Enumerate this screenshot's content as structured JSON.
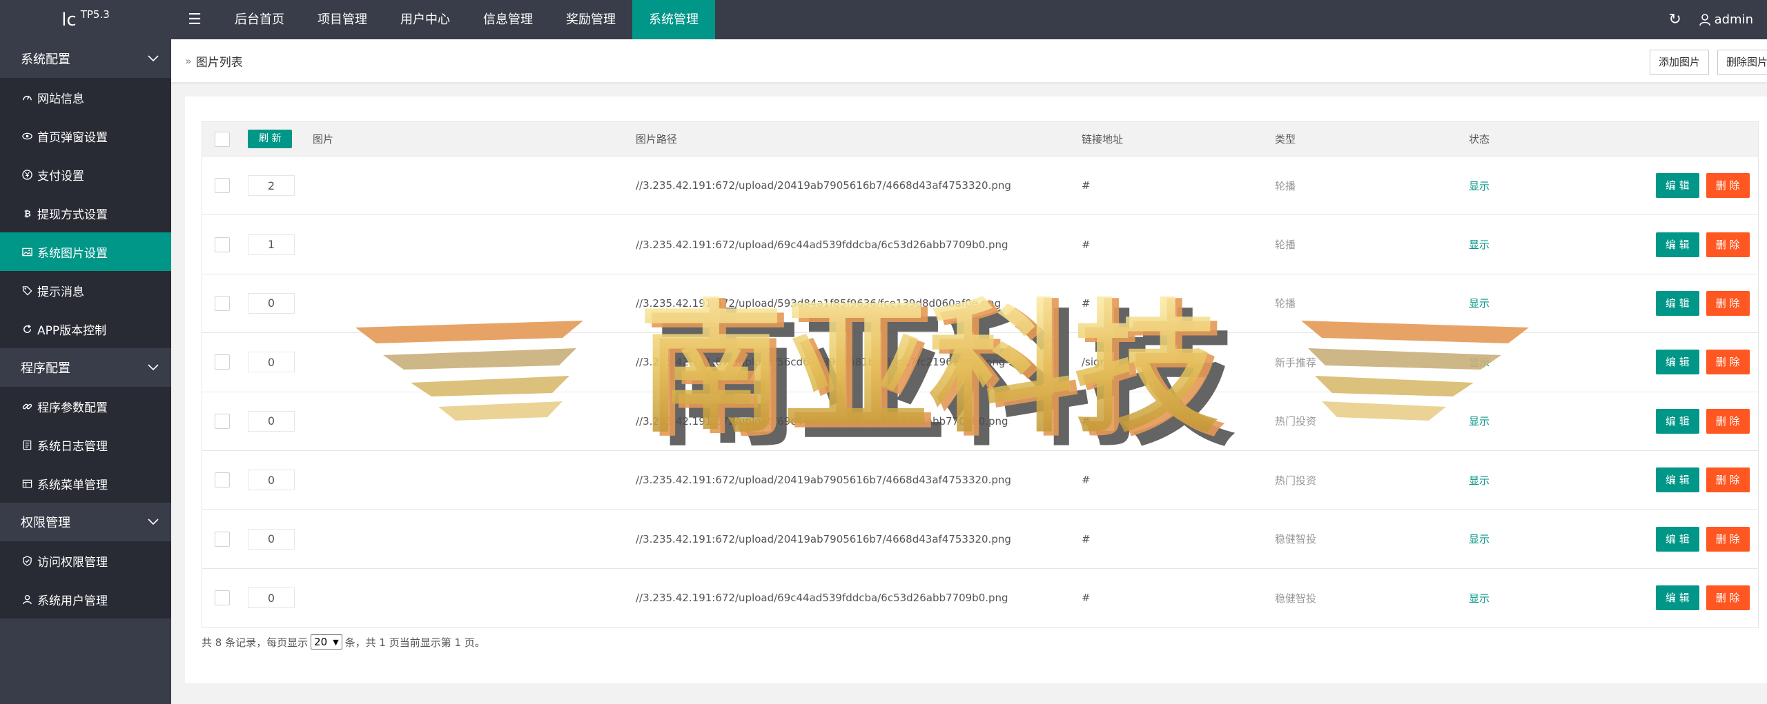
{
  "app": {
    "logo_main": "lc",
    "logo_version": "TP5.3",
    "user": "admin"
  },
  "topnav": [
    {
      "label": "后台首页",
      "active": false
    },
    {
      "label": "项目管理",
      "active": false
    },
    {
      "label": "用户中心",
      "active": false
    },
    {
      "label": "信息管理",
      "active": false
    },
    {
      "label": "奖励管理",
      "active": false
    },
    {
      "label": "系统管理",
      "active": true
    }
  ],
  "sidebar": {
    "groups": [
      {
        "label": "系统配置",
        "items": [
          {
            "label": "网站信息",
            "icon": "dashboard-icon"
          },
          {
            "label": "首页弹窗设置",
            "icon": "eye-icon"
          },
          {
            "label": "支付设置",
            "icon": "yen-icon"
          },
          {
            "label": "提现方式设置",
            "icon": "bitcoin-icon"
          },
          {
            "label": "系统图片设置",
            "icon": "image-icon",
            "active": true
          },
          {
            "label": "提示消息",
            "icon": "tag-icon"
          },
          {
            "label": "APP版本控制",
            "icon": "refresh-icon"
          }
        ]
      },
      {
        "label": "程序配置",
        "items": [
          {
            "label": "程序参数配置",
            "icon": "link-icon"
          },
          {
            "label": "系统日志管理",
            "icon": "log-icon"
          },
          {
            "label": "系统菜单管理",
            "icon": "table-icon"
          }
        ]
      },
      {
        "label": "权限管理",
        "items": [
          {
            "label": "访问权限管理",
            "icon": "shield-icon"
          },
          {
            "label": "系统用户管理",
            "icon": "user-icon"
          }
        ]
      }
    ]
  },
  "breadcrumb": "图片列表",
  "actions": {
    "add": "添加图片",
    "delete": "删除图片"
  },
  "table": {
    "refresh_label": "刷 新",
    "headers": {
      "image": "图片",
      "path": "图片路径",
      "link": "链接地址",
      "type": "类型",
      "status": "状态"
    },
    "edit_label": "编 辑",
    "delete_label": "删 除",
    "rows": [
      {
        "sort": "2",
        "path": "//3.235.42.191:672/upload/20419ab7905616b7/4668d43af4753320.png",
        "link": "#",
        "type": "轮播",
        "status": "显示"
      },
      {
        "sort": "1",
        "path": "//3.235.42.191:672/upload/69c44ad539fddcba/6c53d26abb7709b0.png",
        "link": "#",
        "type": "轮播",
        "status": "显示"
      },
      {
        "sort": "0",
        "path": "//3.235.42.191:672/upload/593d84a1f85f9636/fce139d8d060af0e.png",
        "link": "#",
        "type": "轮播",
        "status": "显示"
      },
      {
        "sort": "0",
        "path": "//3.235.42.191:672/upload/56cd67e39a5681ba/35dc7fc21961f80b.png",
        "link": "/sign",
        "type": "新手推荐",
        "status": "显示"
      },
      {
        "sort": "0",
        "path": "//3.235.42.191:672/upload/69c44ad539fddcba/6c53d26abb7709b0.png",
        "link": "#",
        "type": "热门投资",
        "status": "显示"
      },
      {
        "sort": "0",
        "path": "//3.235.42.191:672/upload/20419ab7905616b7/4668d43af4753320.png",
        "link": "#",
        "type": "热门投资",
        "status": "显示"
      },
      {
        "sort": "0",
        "path": "//3.235.42.191:672/upload/20419ab7905616b7/4668d43af4753320.png",
        "link": "#",
        "type": "稳健智投",
        "status": "显示"
      },
      {
        "sort": "0",
        "path": "//3.235.42.191:672/upload/69c44ad539fddcba/6c53d26abb7709b0.png",
        "link": "#",
        "type": "稳健智投",
        "status": "显示"
      }
    ]
  },
  "pager": {
    "prefix": "共 8 条记录，每页显示",
    "page_size": "20",
    "suffix": "条，共 1 页当前显示第 1 页。"
  },
  "watermark": "南亚科技",
  "colors": {
    "primary": "#009688",
    "danger": "#ff5722",
    "dark": "#393d49",
    "sidebar_item": "#282b33"
  }
}
